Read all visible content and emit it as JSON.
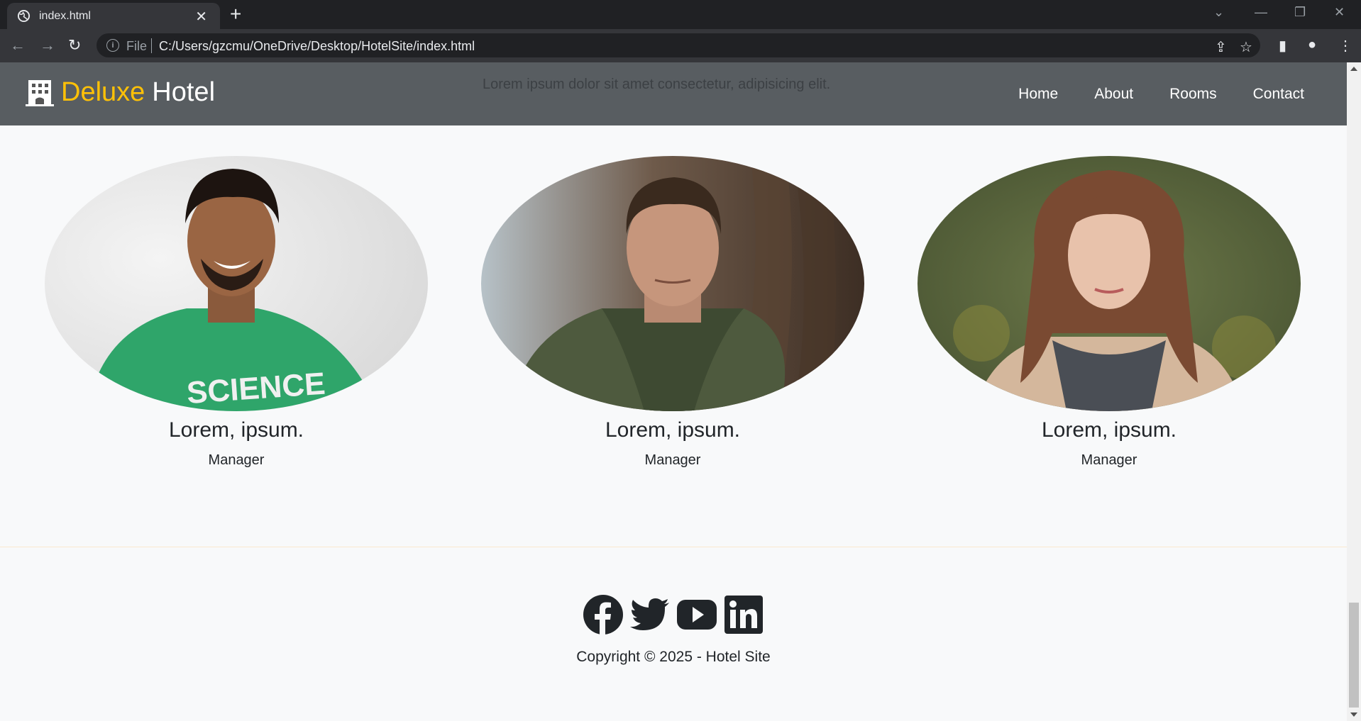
{
  "browser": {
    "tab_title": "index.html",
    "scheme_label": "File",
    "url": "C:/Users/gzcmu/OneDrive/Desktop/HotelSite/index.html"
  },
  "site": {
    "brand_accent": "Deluxe",
    "brand_rest": "Hotel",
    "tagline": "Lorem ipsum dolor sit amet consectetur, adipisicing elit.",
    "nav": [
      "Home",
      "About",
      "Rooms",
      "Contact"
    ],
    "accent_color": "#ffc107"
  },
  "team": [
    {
      "name": "Lorem, ipsum.",
      "role": "Manager",
      "photo": "man-green-science-tshirt"
    },
    {
      "name": "Lorem, ipsum.",
      "role": "Manager",
      "photo": "man-green-jacket"
    },
    {
      "name": "Lorem, ipsum.",
      "role": "Manager",
      "photo": "woman-long-hair"
    }
  ],
  "footer": {
    "social_icons": [
      "facebook-icon",
      "twitter-icon",
      "youtube-icon",
      "linkedin-icon"
    ],
    "copyright": "Copyright © 2025 - Hotel Site"
  }
}
